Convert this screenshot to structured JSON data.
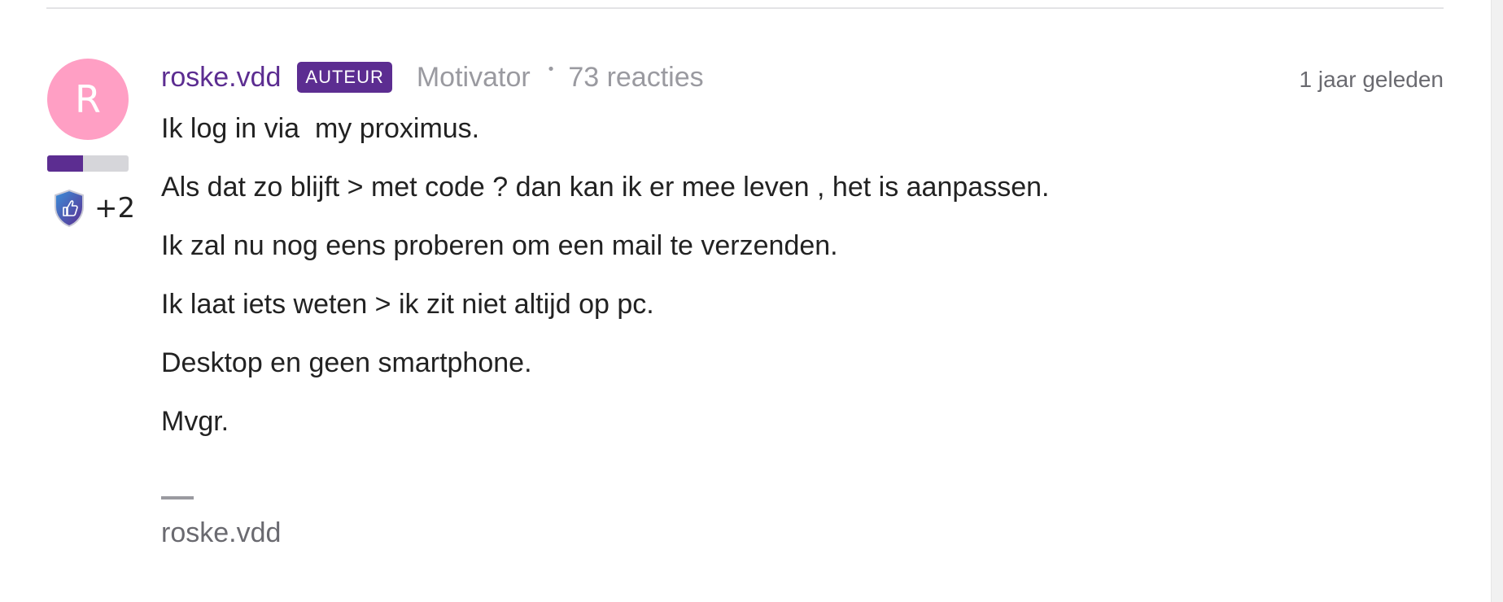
{
  "post": {
    "avatar": {
      "initial": "R",
      "color": "#ff9fc4"
    },
    "progress_fraction": 0.44,
    "badge": {
      "icon": "shield-thumbs-up-icon",
      "count": "+2"
    },
    "username": "roske.vdd",
    "role_badge": "AUTEUR",
    "rank": "Motivator",
    "separator": "•",
    "reactions": "73 reacties",
    "timestamp": "1 jaar geleden",
    "lines": [
      "Ik log in via  my proximus.",
      "Als dat zo blijft > met code ? dan kan ik er mee leven , het is aanpassen.",
      "Ik zal nu nog eens proberen om een mail te verzenden.",
      "Ik laat iets weten > ik zit niet altijd op pc.",
      "Desktop en geen smartphone.",
      "Mvgr."
    ],
    "signature": "roske.vdd"
  },
  "colors": {
    "accent": "#5c2d91",
    "muted_text": "#9a9aa0",
    "avatar_bg": "#ff9fc4"
  }
}
